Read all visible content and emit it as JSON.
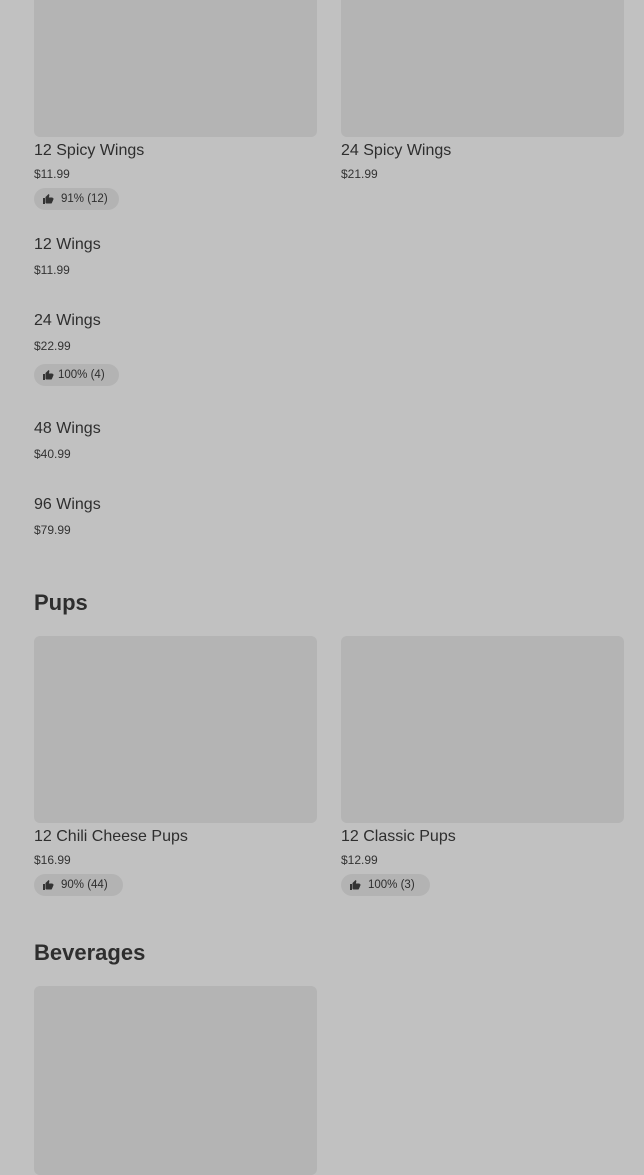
{
  "wings": {
    "grid": [
      {
        "name": "12 Spicy Wings",
        "price": "$11.99",
        "rating": "91% (12)"
      },
      {
        "name": "24 Spicy Wings",
        "price": "$21.99"
      }
    ],
    "list": [
      {
        "name": "12 Wings",
        "price": "$11.99"
      },
      {
        "name": "24 Wings",
        "price": "$22.99",
        "rating": "100% (4)"
      },
      {
        "name": "48 Wings",
        "price": "$40.99"
      },
      {
        "name": "96 Wings",
        "price": "$79.99"
      }
    ]
  },
  "pups": {
    "title": "Pups",
    "items": [
      {
        "name": "12 Chili Cheese Pups",
        "price": "$16.99",
        "rating": "90% (44)"
      },
      {
        "name": "12 Classic Pups",
        "price": "$12.99",
        "rating": "100% (3)"
      }
    ]
  },
  "beverages": {
    "title": "Beverages"
  },
  "icons": {
    "rating": "thumbs-up-icon"
  }
}
